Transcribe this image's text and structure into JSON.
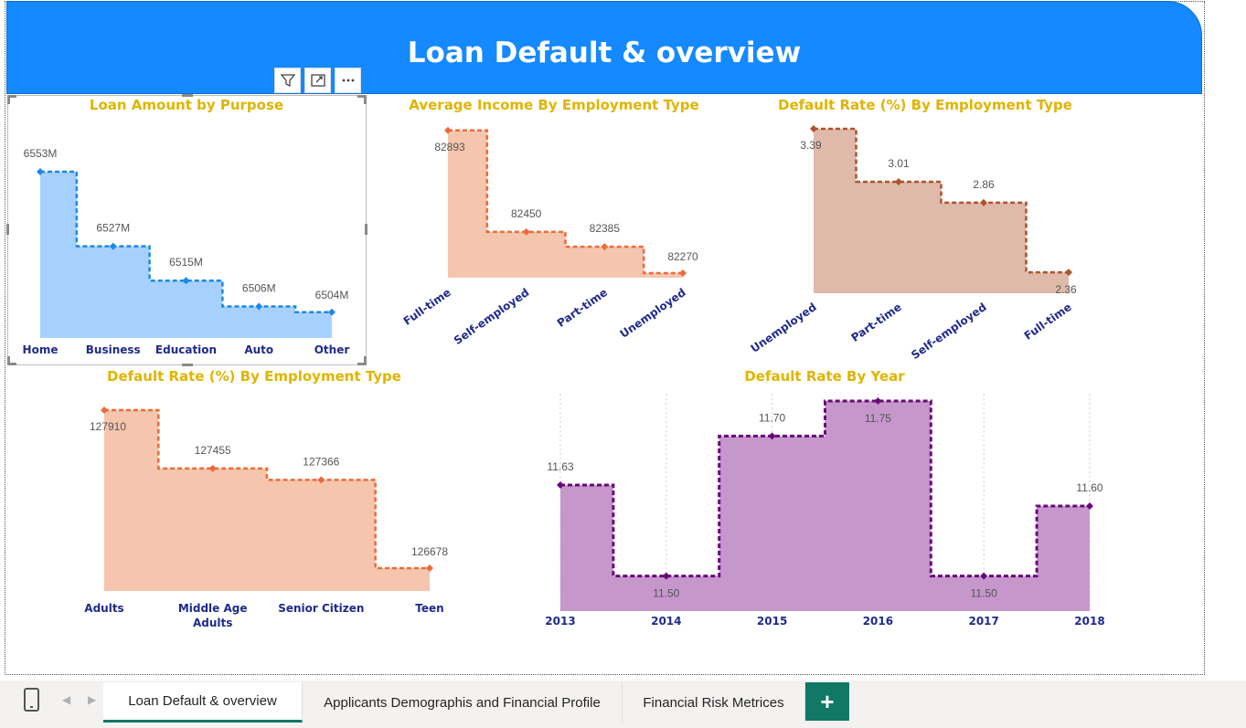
{
  "page": {
    "title": "Loan Default & overview"
  },
  "toolbar": {
    "filter_icon": "filter-icon",
    "focus_icon": "focus-mode-icon",
    "more_icon": "more-options-icon"
  },
  "colors": {
    "banner": "#1589ff",
    "title_gold": "#e0b400",
    "category_navy": "#1f2a8c",
    "tab_accent": "#117865"
  },
  "tabs": [
    {
      "label": "Loan Default & overview",
      "active": true
    },
    {
      "label": "Applicants Demographis and Financial Profile",
      "active": false
    },
    {
      "label": "Financial Risk Metrices",
      "active": false
    }
  ],
  "add_tab_label": "+",
  "chart_data": [
    {
      "type": "area",
      "step": true,
      "title": "Loan Amount by Purpose",
      "categories": [
        "Home",
        "Business",
        "Education",
        "Auto",
        "Other"
      ],
      "values": [
        6553,
        6527,
        6515,
        6506,
        6504
      ],
      "value_labels": [
        "6553M",
        "6527M",
        "6515M",
        "6506M",
        "6504M"
      ],
      "ylim": [
        6495,
        6560
      ],
      "fill": "#a6d1ff",
      "line": "#1e88e5",
      "label_mode": "above"
    },
    {
      "type": "area",
      "step": true,
      "title": "Average Income By Employment Type",
      "categories": [
        "Full-time",
        "Self-employed",
        "Part-time",
        "Unemployed"
      ],
      "values": [
        82893,
        82450,
        82385,
        82270
      ],
      "value_labels": [
        "82893",
        "82450",
        "82385",
        "82270"
      ],
      "ylim": [
        82250,
        82900
      ],
      "fill": "#f5c5ad",
      "line": "#ed6b3a",
      "rotated_labels": true,
      "label_mode": "mixed"
    },
    {
      "type": "area",
      "step": true,
      "title": "Default Rate (%) By Employment Type",
      "categories": [
        "Unemployed",
        "Part-time",
        "Self-employed",
        "Full-time"
      ],
      "values": [
        3.39,
        3.01,
        2.86,
        2.36
      ],
      "value_labels": [
        "3.39",
        "3.01",
        "2.86",
        "2.36"
      ],
      "ylim": [
        2.21,
        3.39
      ],
      "fill": "#dfb9aa",
      "line": "#b0522a",
      "rotated_labels": true,
      "label_mode": "mixed3"
    },
    {
      "type": "area",
      "step": true,
      "title": "Default Rate (%) By Employment Type",
      "categories": [
        "Adults",
        "Middle Age Adults",
        "Senior Citizen",
        "Teen"
      ],
      "category_lines": [
        [
          "Adults"
        ],
        [
          "Middle Age",
          "Adults"
        ],
        [
          "Senior Citizen"
        ],
        [
          "Teen"
        ]
      ],
      "values": [
        127910,
        127455,
        127366,
        126678
      ],
      "value_labels": [
        "127910",
        "127455",
        "127366",
        "126678"
      ],
      "ylim": [
        126500,
        127910
      ],
      "fill": "#f5c5ad",
      "line": "#ed6b3a",
      "label_mode": "mixed4"
    },
    {
      "type": "area",
      "step": true,
      "title": "Default Rate By Year",
      "categories": [
        "2013",
        "2014",
        "2015",
        "2016",
        "2017",
        "2018"
      ],
      "values": [
        11.63,
        11.5,
        11.7,
        11.75,
        11.5,
        11.6
      ],
      "value_labels": [
        "11.63",
        "11.50",
        "11.70",
        "11.75",
        "11.50",
        "11.60"
      ],
      "ylim": [
        11.45,
        11.75
      ],
      "fill": "#c597cb",
      "line": "#6a0a7a",
      "gridlines": true,
      "label_mode": "year"
    }
  ]
}
